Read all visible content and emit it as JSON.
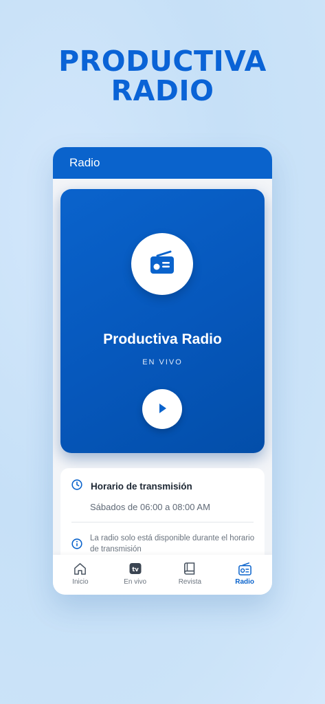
{
  "promo": {
    "line1": "PRODUCTIVA",
    "line2": "RADIO"
  },
  "appbar": {
    "title": "Radio"
  },
  "player": {
    "icon": "radio-icon",
    "station_name": "Productiva Radio",
    "status": "EN VIVO",
    "play_icon": "play-icon"
  },
  "info": {
    "title_icon": "clock-icon",
    "title": "Horario de transmisión",
    "schedule": "Sábados de 06:00 a 08:00 AM",
    "note_icon": "info-icon",
    "note": "La radio solo está disponible durante el horario de transmisión"
  },
  "tabs": [
    {
      "label": "Inicio",
      "icon": "home-icon",
      "active": false
    },
    {
      "label": "En vivo",
      "icon": "tv-icon",
      "active": false
    },
    {
      "label": "Revista",
      "icon": "book-icon",
      "active": false
    },
    {
      "label": "Radio",
      "icon": "radio-icon",
      "active": true
    }
  ],
  "colors": {
    "brand": "#0a63cc",
    "headline": "#0a63d6",
    "background": "#cbe3f8"
  }
}
